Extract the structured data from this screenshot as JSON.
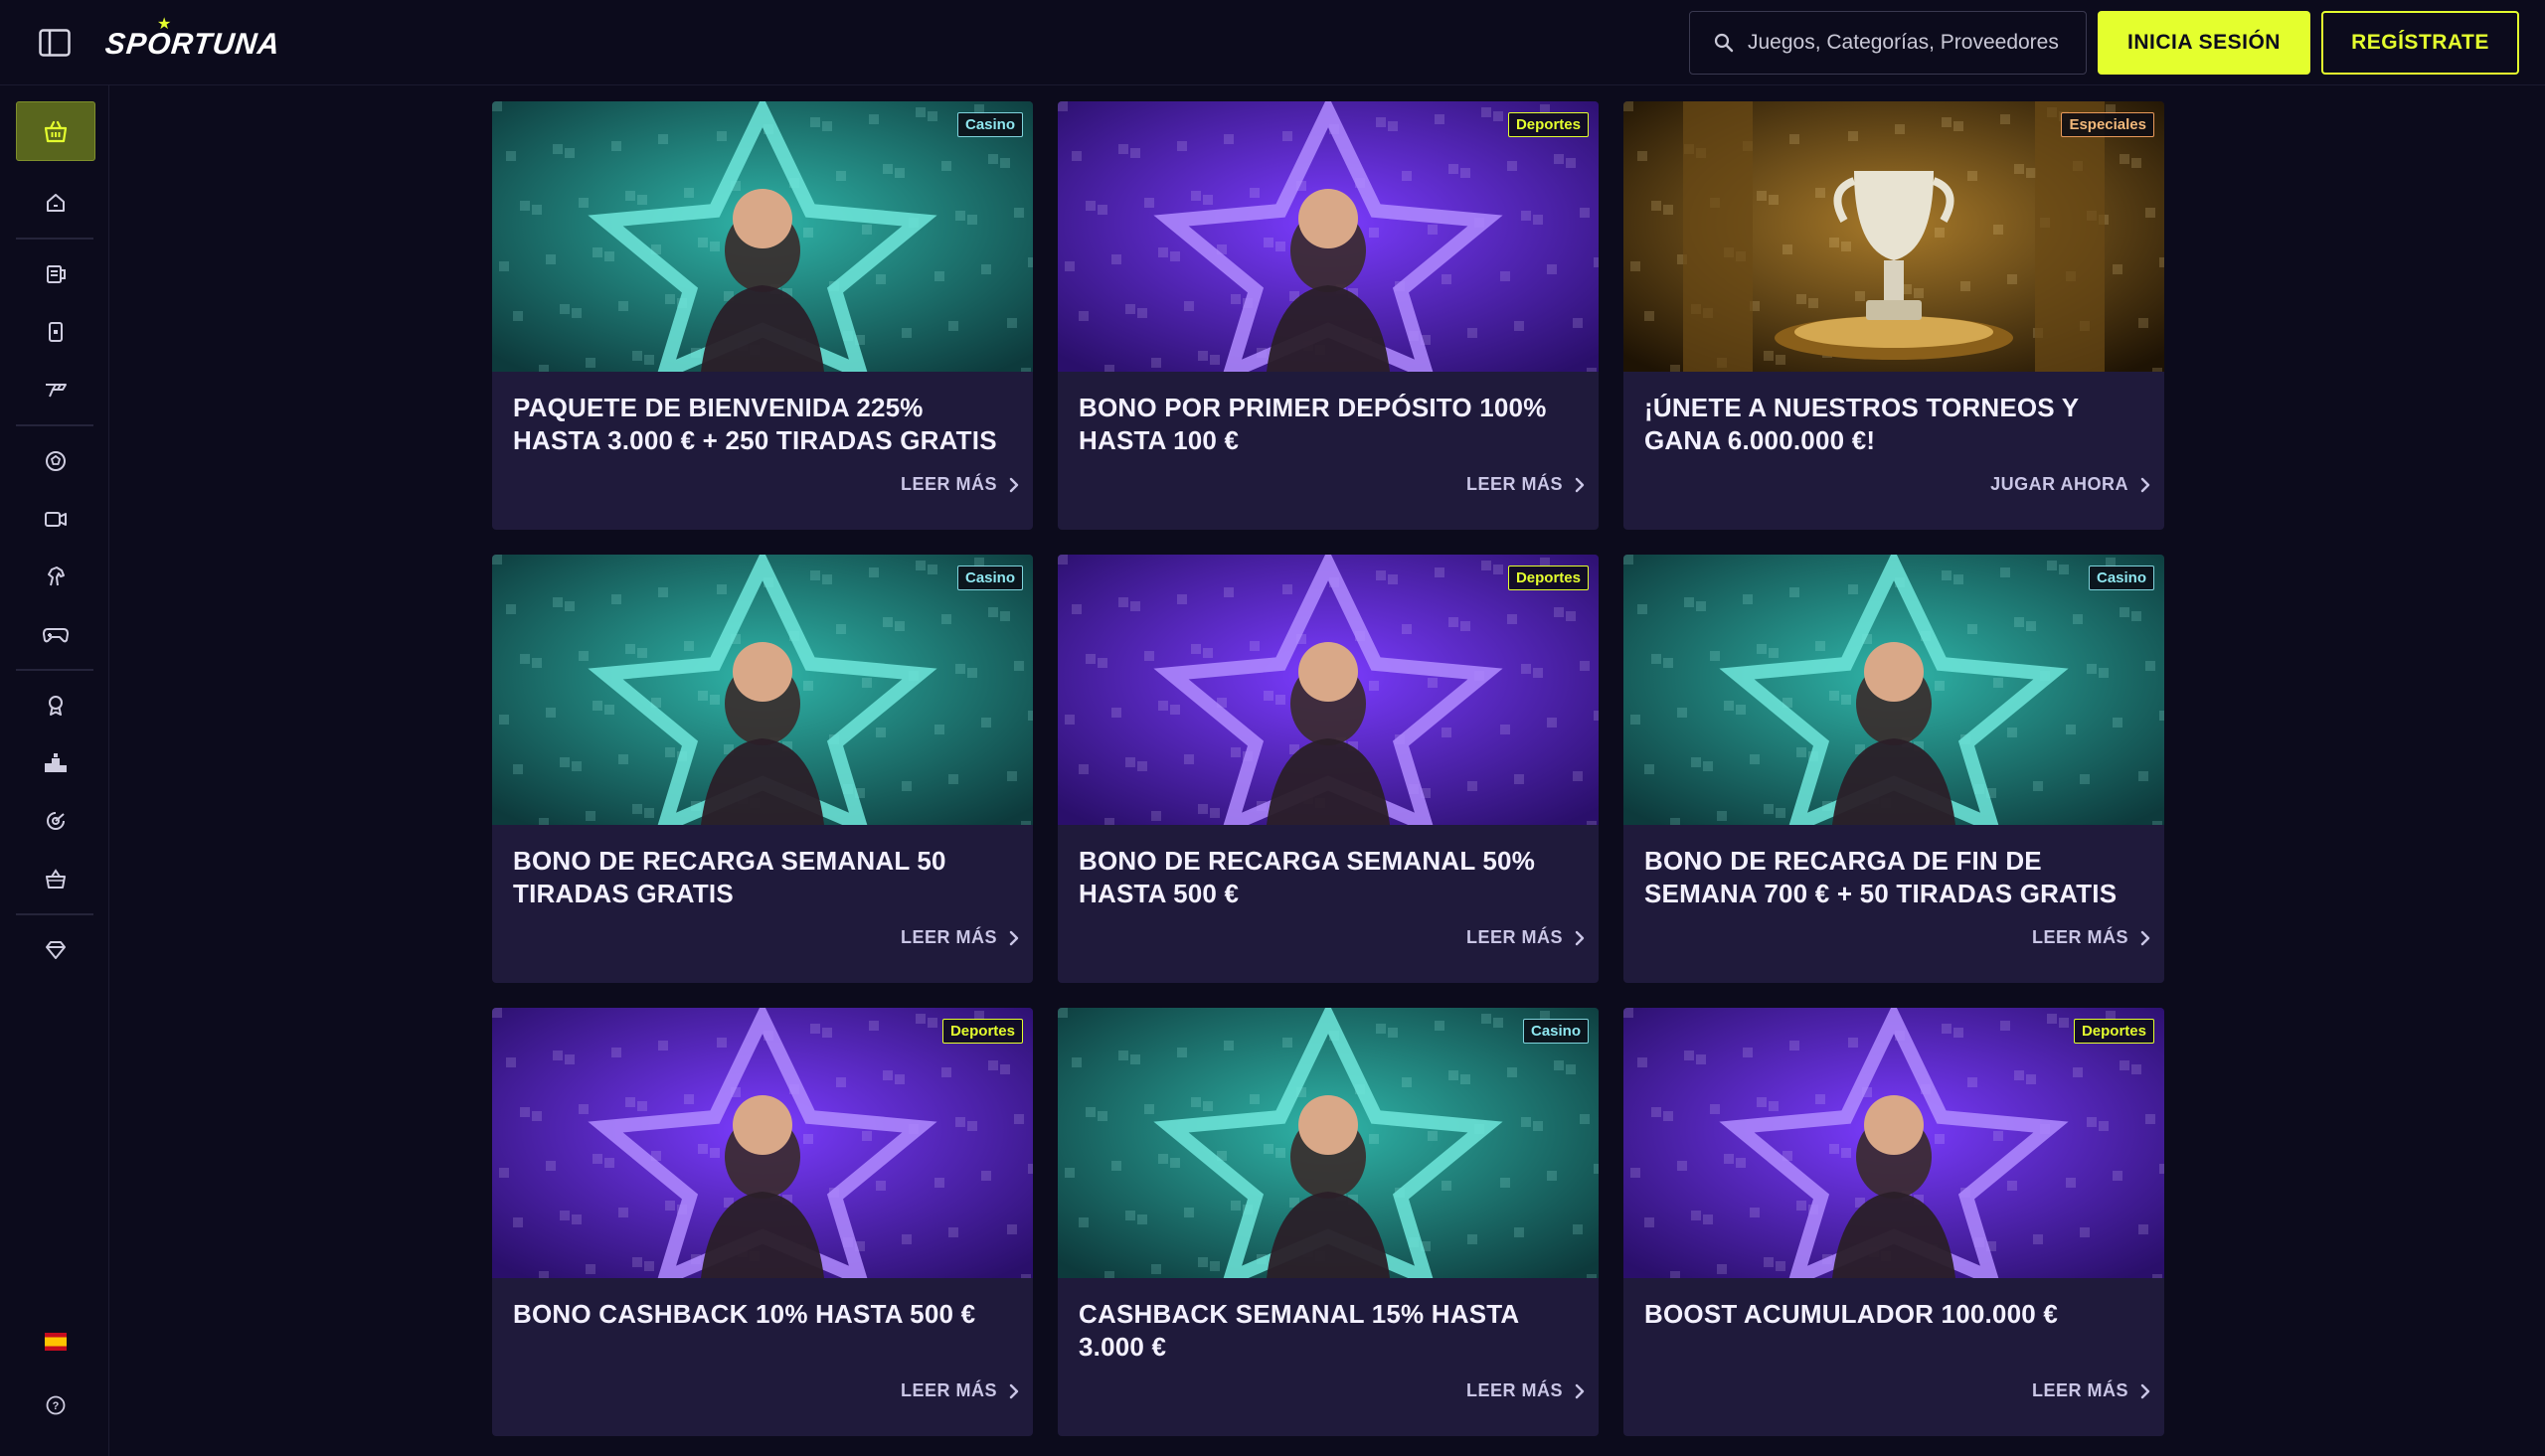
{
  "header": {
    "logo_text": "SPORTUNA",
    "search_placeholder": "Juegos, Categorías, Proveedores",
    "login_label": "INICIA SESIÓN",
    "register_label": "REGÍSTRATE"
  },
  "colors": {
    "accent": "#e4ff2e",
    "background": "#0c0b1c",
    "card_bg": "#1f1a3b",
    "casino_badge": "#8fe7f0",
    "deportes_badge": "#e4ff2e",
    "especiales_badge": "#f2b87a"
  },
  "sidebar": {
    "items": [
      {
        "icon": "gift-basket-icon",
        "active": true
      },
      {
        "icon": "home-icon"
      },
      {
        "icon": "betslip-icon"
      },
      {
        "icon": "phone-card-icon"
      },
      {
        "icon": "boost-icon"
      },
      {
        "icon": "soccer-ball-icon"
      },
      {
        "icon": "live-camera-icon"
      },
      {
        "icon": "horse-icon"
      },
      {
        "icon": "gamepad-icon"
      },
      {
        "icon": "award-icon"
      },
      {
        "icon": "podium-icon"
      },
      {
        "icon": "wheel-icon"
      },
      {
        "icon": "shop-basket-icon"
      },
      {
        "icon": "diamond-icon"
      },
      {
        "icon": "spain-flag-icon"
      },
      {
        "icon": "help-icon"
      }
    ]
  },
  "promotions": [
    {
      "badge": "Casino",
      "badge_type": "casino",
      "title": "PAQUETE DE BIENVENIDA 225% HASTA 3.000 € + 250 TIRADAS GRATIS",
      "link": "LEER MÁS",
      "theme": "teal"
    },
    {
      "badge": "Deportes",
      "badge_type": "deportes",
      "title": "BONO POR PRIMER DEPÓSITO 100% HASTA 100 €",
      "link": "LEER MÁS",
      "theme": "purple"
    },
    {
      "badge": "Especiales",
      "badge_type": "especiales",
      "title": "¡ÚNETE A NUESTROS TORNEOS Y GANA 6.000.000 €!",
      "link": "JUGAR AHORA",
      "theme": "gold"
    },
    {
      "badge": "Casino",
      "badge_type": "casino",
      "title": "BONO DE RECARGA SEMANAL 50 TIRADAS GRATIS",
      "link": "LEER MÁS",
      "theme": "teal"
    },
    {
      "badge": "Deportes",
      "badge_type": "deportes",
      "title": "BONO DE RECARGA SEMANAL 50% HASTA 500 €",
      "link": "LEER MÁS",
      "theme": "purple"
    },
    {
      "badge": "Casino",
      "badge_type": "casino",
      "title": "BONO DE RECARGA DE FIN DE SEMANA 700 € + 50 TIRADAS GRATIS",
      "link": "LEER MÁS",
      "theme": "teal"
    },
    {
      "badge": "Deportes",
      "badge_type": "deportes",
      "title": "BONO CASHBACK 10% HASTA 500 €",
      "link": "LEER MÁS",
      "theme": "purple"
    },
    {
      "badge": "Casino",
      "badge_type": "casino",
      "title": "CASHBACK SEMANAL 15% HASTA 3.000 €",
      "link": "LEER MÁS",
      "theme": "teal"
    },
    {
      "badge": "Deportes",
      "badge_type": "deportes",
      "title": "BOOST ACUMULADOR 100.000 €",
      "link": "LEER MÁS",
      "theme": "purple"
    }
  ]
}
